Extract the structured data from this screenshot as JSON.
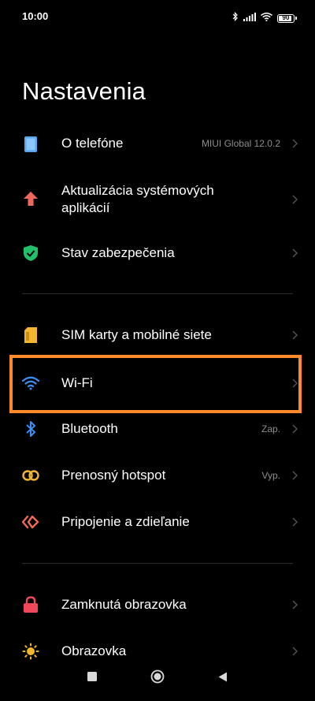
{
  "status": {
    "time": "10:00",
    "battery": "90",
    "battery_fraction": 0.9
  },
  "title": "Nastavenia",
  "items": [
    {
      "id": "o-telefone",
      "label": "O telefóne",
      "value": "MIUI Global 12.0.2",
      "icon": "phone-info-icon",
      "color": "#5aa8f0"
    },
    {
      "id": "aktualizacia",
      "label": "Aktualizácia systémových aplikácií",
      "value": "",
      "icon": "arrow-up-icon",
      "color": "#f0685a"
    },
    {
      "id": "zabezpecenie",
      "label": "Stav zabezpečenia",
      "value": "",
      "icon": "shield-check-icon",
      "color": "#22c06a"
    },
    {
      "id": "sim",
      "label": "SIM karty a mobilné siete",
      "value": "",
      "icon": "sim-card-icon",
      "color": "#f3b630"
    },
    {
      "id": "wifi",
      "label": "Wi-Fi",
      "value": "",
      "icon": "wifi-icon",
      "color": "#3b8ff5"
    },
    {
      "id": "bluetooth",
      "label": "Bluetooth",
      "value": "Zap.",
      "icon": "bluetooth-icon",
      "color": "#3b8ff5"
    },
    {
      "id": "hotspot",
      "label": "Prenosný hotspot",
      "value": "Vyp.",
      "icon": "hotspot-icon",
      "color": "#f3b630"
    },
    {
      "id": "pripojenie",
      "label": "Pripojenie a zdieľanie",
      "value": "",
      "icon": "connection-share-icon",
      "color": "#f0685a"
    },
    {
      "id": "zamknuta",
      "label": "Zamknutá obrazovka",
      "value": "",
      "icon": "lock-icon",
      "color": "#f0485a"
    },
    {
      "id": "obrazovka",
      "label": "Obrazovka",
      "value": "",
      "icon": "sun-icon",
      "color": "#f3b630"
    }
  ],
  "highlight_color": "#ff8a2a"
}
